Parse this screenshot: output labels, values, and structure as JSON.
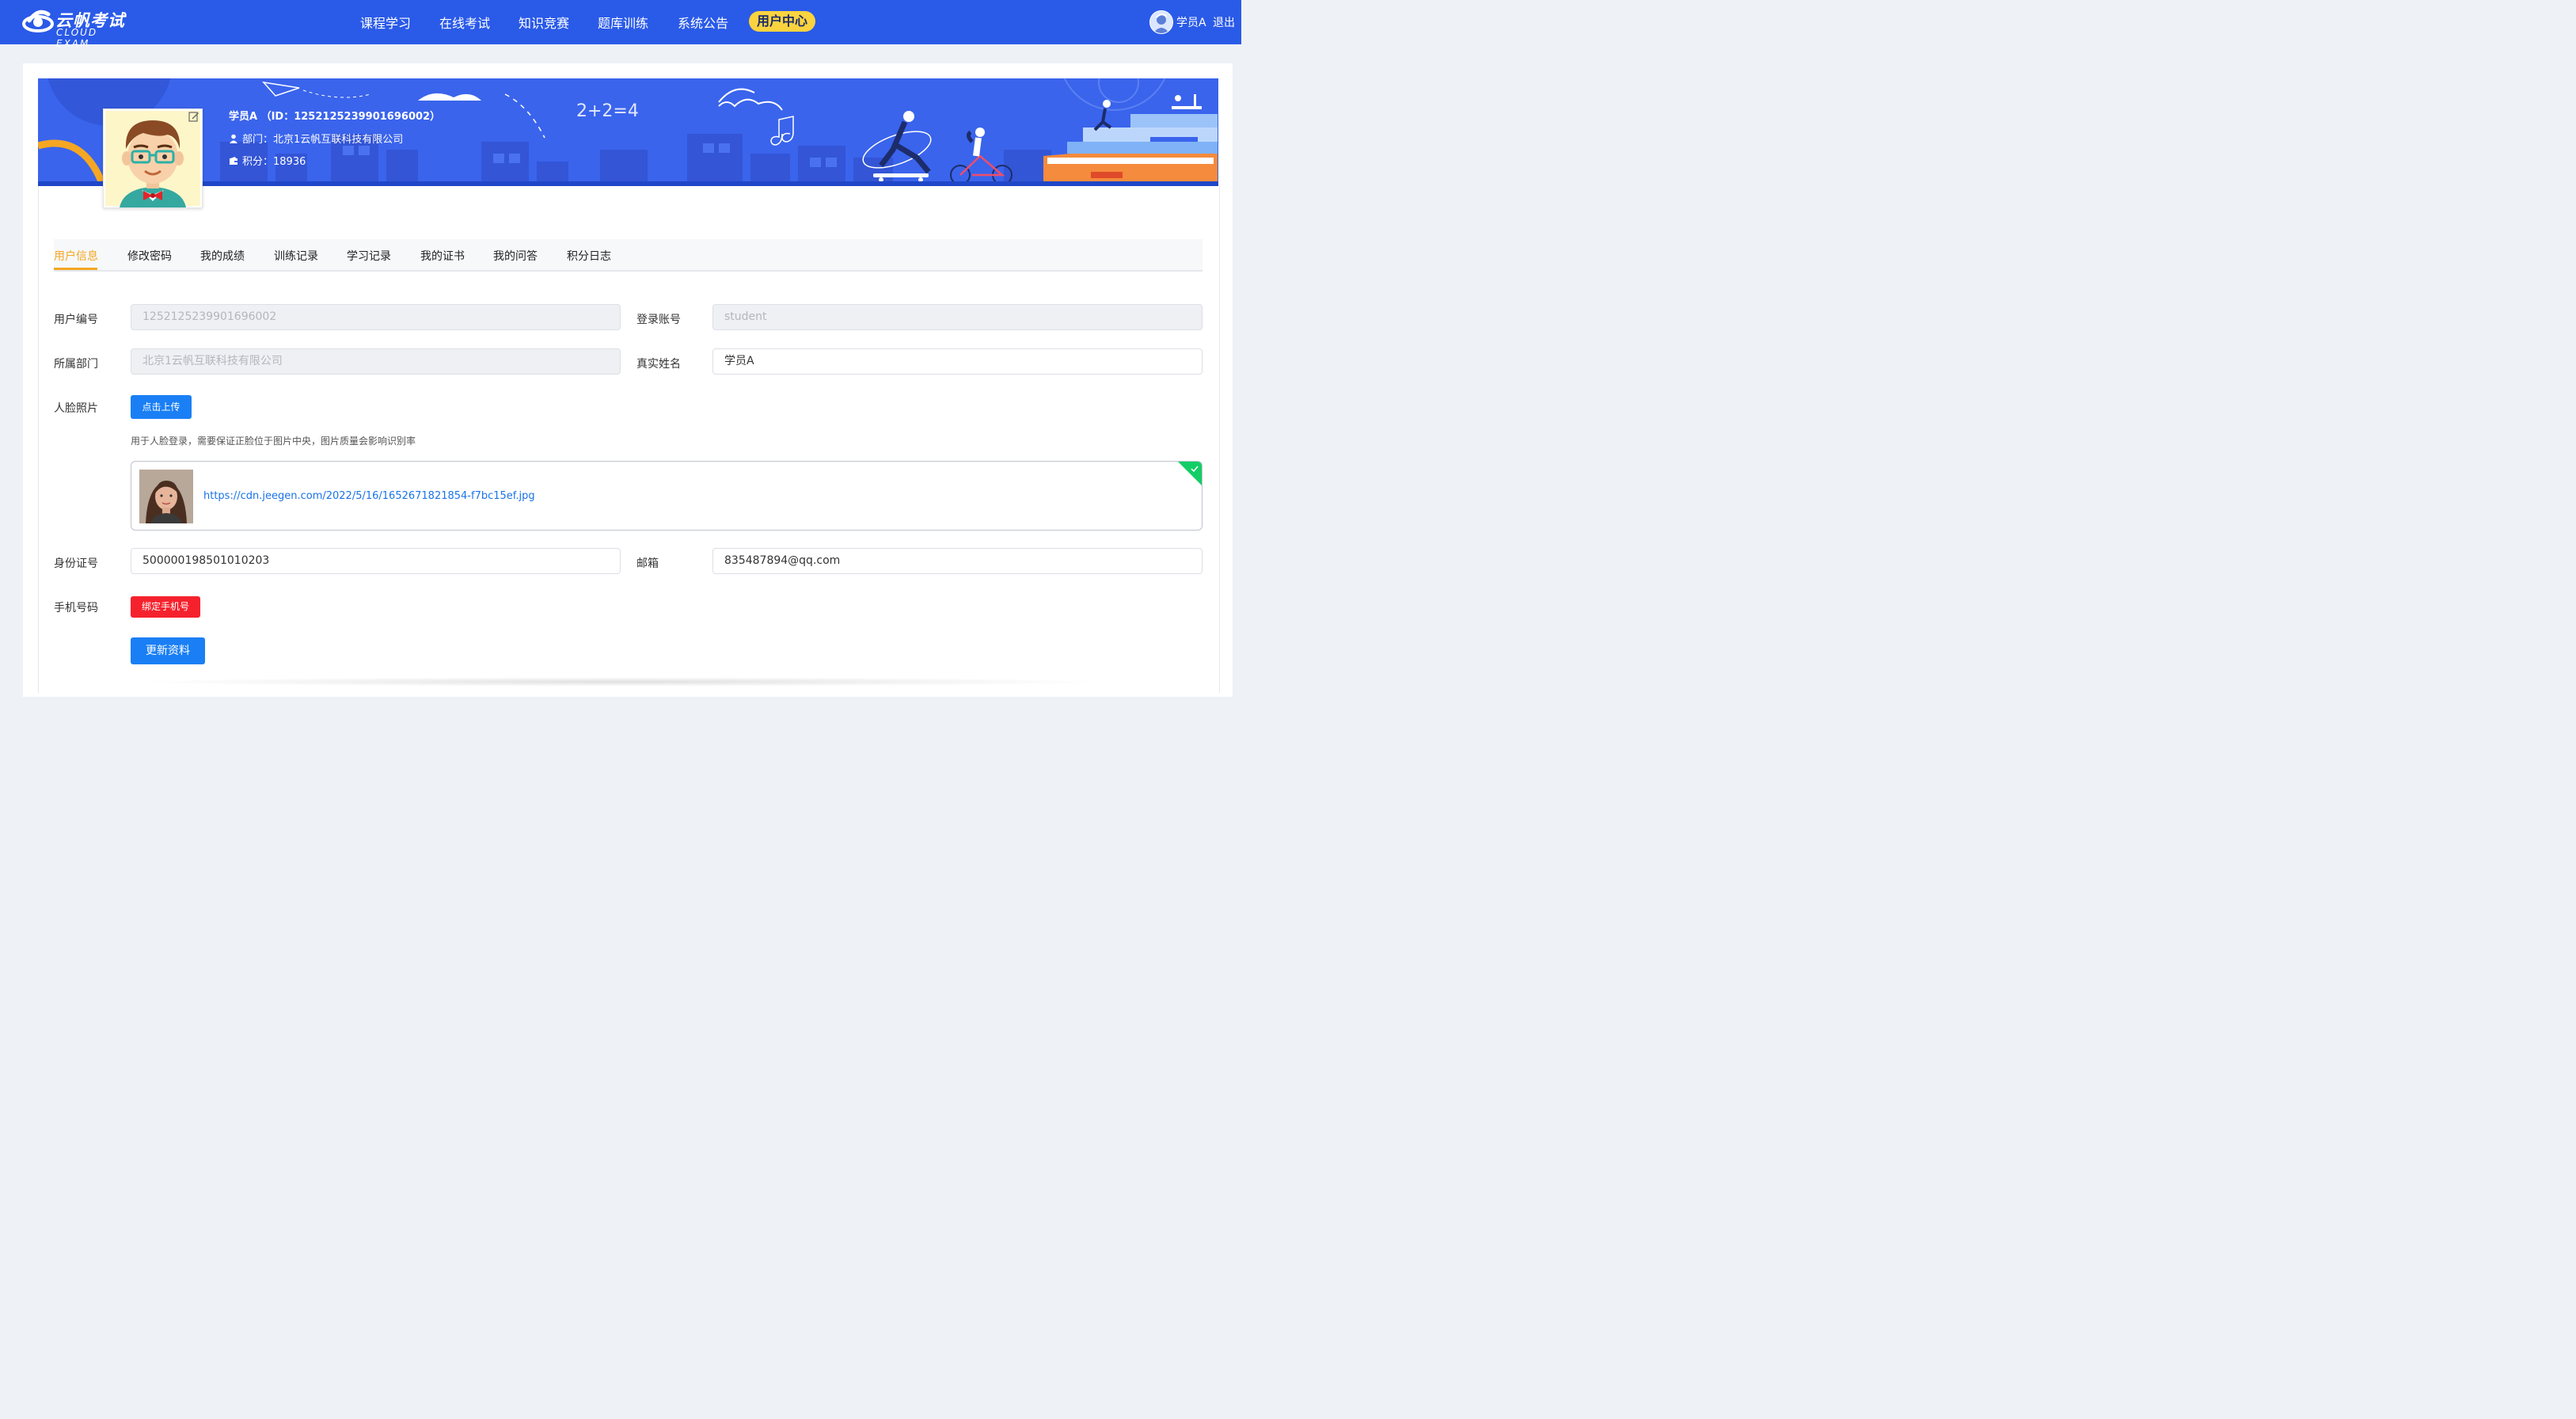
{
  "brand": {
    "name_zh": "云帆考试",
    "name_en": "CLOUD EXAM"
  },
  "nav": {
    "items": [
      "课程学习",
      "在线考试",
      "知识竞赛",
      "题库训练",
      "系统公告"
    ],
    "active": "用户中心",
    "user_name": "学员A",
    "logout": "退出"
  },
  "profile": {
    "name_line": "学员A （ID：1252125239901696002）",
    "dept_line": "部门：北京1云帆互联科技有限公司",
    "points_line": "积分：18936",
    "banner_doodle": "2+2=4"
  },
  "tabs": {
    "items": [
      "用户信息",
      "修改密码",
      "我的成绩",
      "训练记录",
      "学习记录",
      "我的证书",
      "我的问答",
      "积分日志"
    ],
    "active_index": 0
  },
  "form": {
    "user_id_label": "用户编号",
    "user_id_value": "1252125239901696002",
    "login_label": "登录账号",
    "login_value": "student",
    "dept_label": "所属部门",
    "dept_value": "北京1云帆互联科技有限公司",
    "realname_label": "真实姓名",
    "realname_value": "学员A",
    "face_label": "人脸照片",
    "upload_button": "点击上传",
    "face_hint": "用于人脸登录，需要保证正脸位于图片中央，图片质量会影响识别率",
    "face_file_url": "https://cdn.jeegen.com/2022/5/16/1652671821854-f7bc15ef.jpg",
    "idcard_label": "身份证号",
    "idcard_value": "500000198501010203",
    "email_label": "邮箱",
    "email_value": "835487894@qq.com",
    "phone_label": "手机号码",
    "bind_phone_button": "绑定手机号",
    "submit_button": "更新资料"
  },
  "colors": {
    "primary": "#2a5ae8",
    "banner": "#3a64ec",
    "accent_yellow": "#fbd33f",
    "tab_active": "#f5a623",
    "button_blue": "#1a7ff5",
    "button_red": "#f5222d",
    "success": "#13ce66"
  }
}
